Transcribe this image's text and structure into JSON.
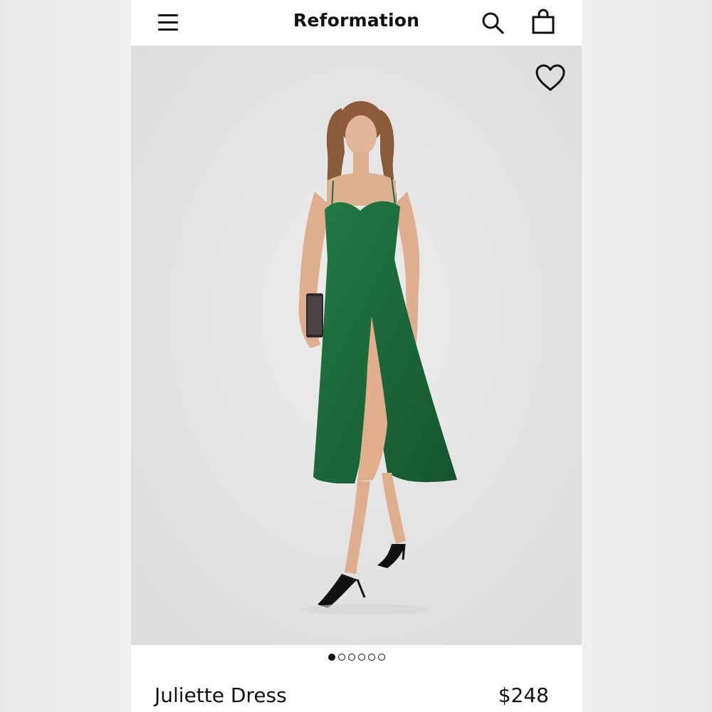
{
  "header": {
    "brand": "Reformation",
    "menu_icon": "hamburger-menu-icon",
    "search_icon": "search-icon",
    "cart_icon": "shopping-bag-icon"
  },
  "hero": {
    "image_subject": "model wearing green midi dress",
    "wishlist_icon": "heart-outline-icon",
    "dress_color": "#1d6a3a",
    "background_color": "#e6e6e6"
  },
  "carousel": {
    "total_slides": 6,
    "active_slide": 1
  },
  "product": {
    "name": "Juliette Dress",
    "price": "$248"
  }
}
